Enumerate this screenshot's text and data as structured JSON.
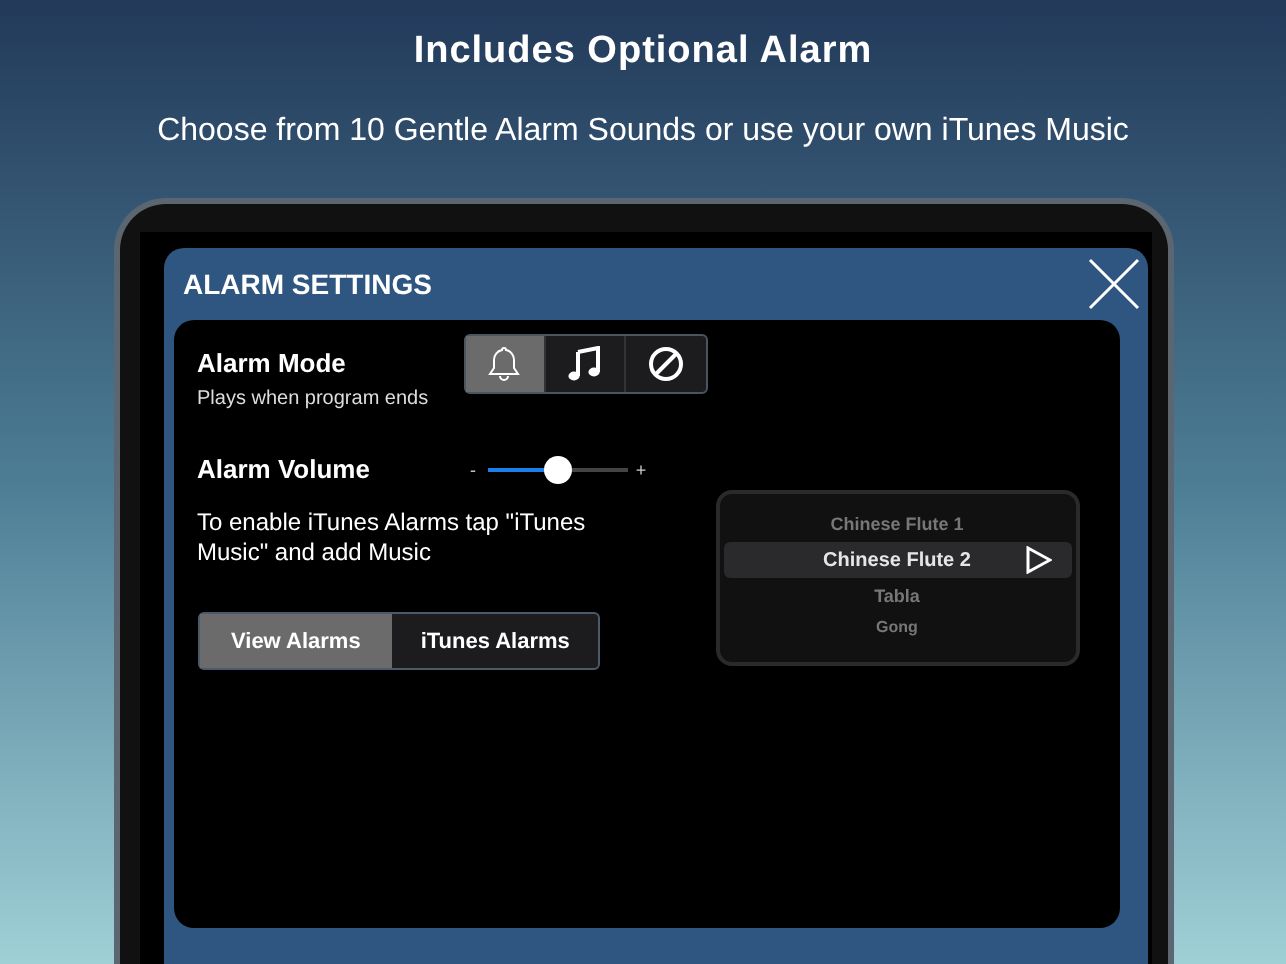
{
  "headline": "Includes Optional Alarm",
  "subtitle": "Choose from 10 Gentle Alarm Sounds or use your own iTunes Music",
  "dialog": {
    "title": "ALARM SETTINGS",
    "alarm_mode": {
      "label": "Alarm Mode",
      "hint": "Plays when program ends",
      "modes": [
        {
          "kind": "bell",
          "selected": true
        },
        {
          "kind": "music",
          "selected": false
        },
        {
          "kind": "none",
          "selected": false
        }
      ]
    },
    "volume": {
      "label": "Alarm Volume",
      "min_label": "-",
      "max_label": "+",
      "level": 0.5
    },
    "note": "To enable iTunes Alarms tap \"iTunes Music\" and add Music",
    "views": [
      {
        "label": "View Alarms",
        "selected": true
      },
      {
        "label": "iTunes Alarms",
        "selected": false
      }
    ],
    "sounds": [
      {
        "label": "Chinese Flute 1",
        "selected": false
      },
      {
        "label": "Chinese Flute 2",
        "selected": true
      },
      {
        "label": "Tabla",
        "selected": false
      },
      {
        "label": "Gong",
        "selected": false
      }
    ]
  }
}
